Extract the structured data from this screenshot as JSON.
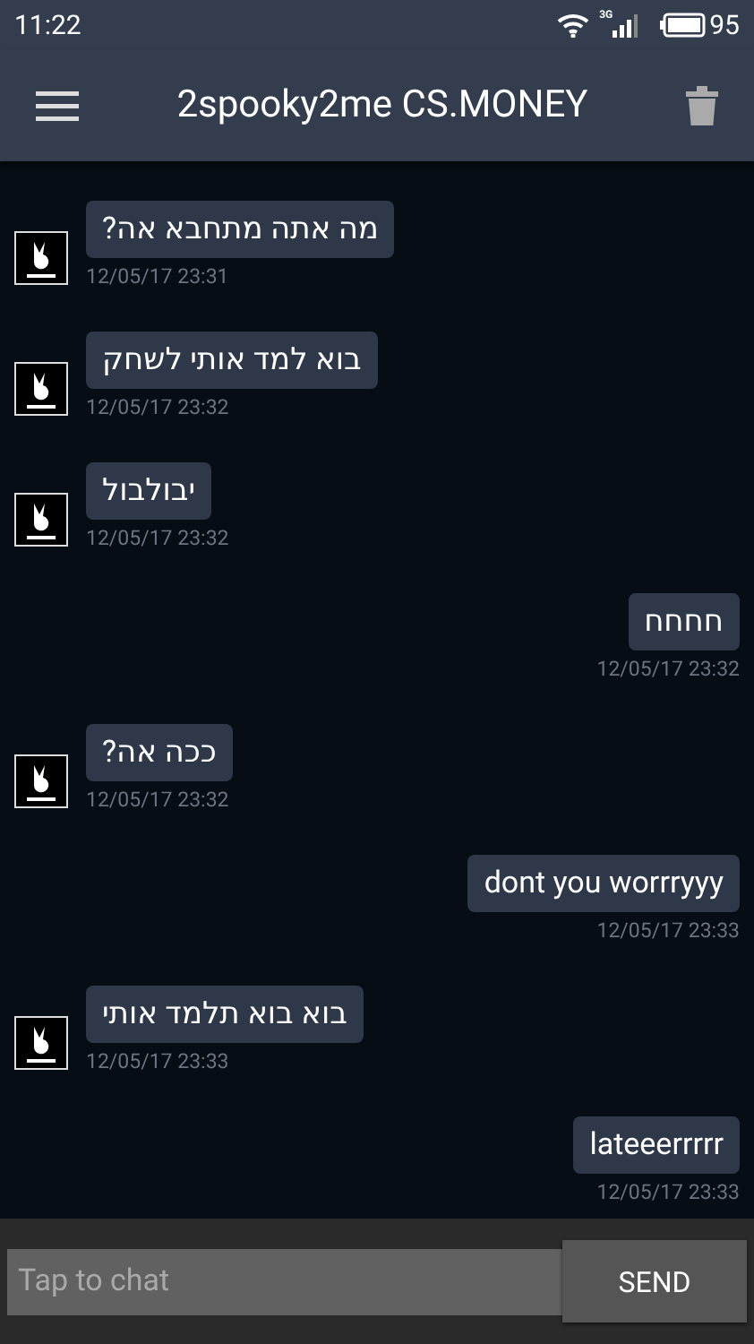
{
  "status_bar": {
    "time": "11:22",
    "network": "3G",
    "battery": "95"
  },
  "header": {
    "title": "2spooky2me CS.MONEY"
  },
  "messages": [
    {
      "kind": "incoming",
      "text": "מה אתה מתחבא אה?",
      "time": "12/05/17 23:31"
    },
    {
      "kind": "incoming",
      "text": "בוא למד אותי לשחק",
      "time": "12/05/17 23:32"
    },
    {
      "kind": "incoming",
      "text": "יבולבול",
      "time": "12/05/17 23:32"
    },
    {
      "kind": "outgoing",
      "text": "חחחח",
      "time": "12/05/17 23:32"
    },
    {
      "kind": "incoming",
      "text": "ככה אה?",
      "time": "12/05/17 23:32"
    },
    {
      "kind": "outgoing",
      "text": "dont you worrryyy",
      "time": "12/05/17 23:33"
    },
    {
      "kind": "incoming",
      "text": "בוא בוא תלמד אותי",
      "time": "12/05/17 23:33"
    },
    {
      "kind": "outgoing",
      "text": "lateeerrrrr",
      "time": "12/05/17 23:33"
    }
  ],
  "composer": {
    "placeholder": "Tap to chat",
    "send_label": "SEND"
  }
}
